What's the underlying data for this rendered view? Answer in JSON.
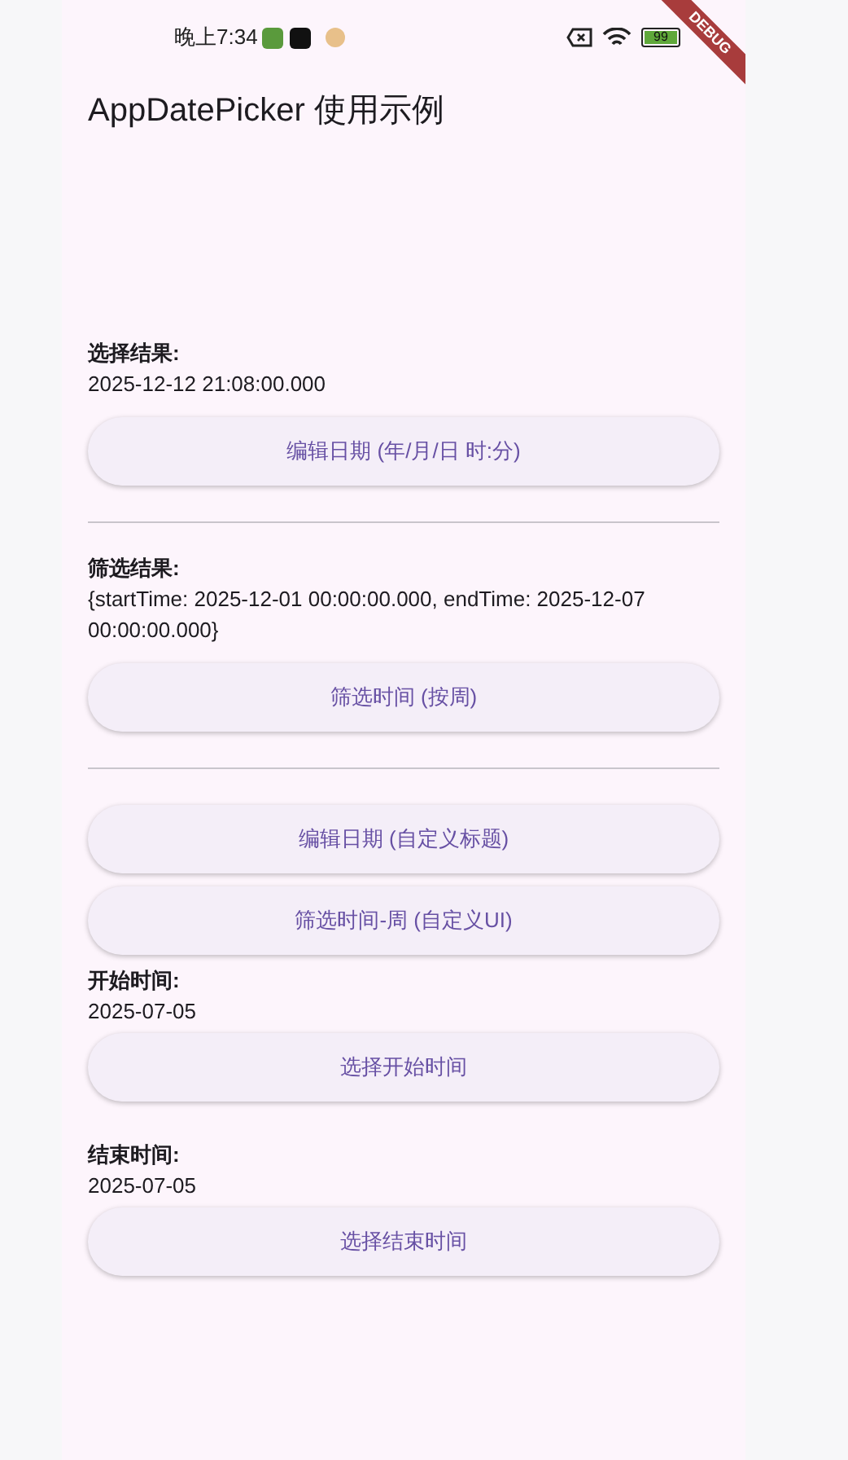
{
  "status_bar": {
    "time": "晚上7:34",
    "battery": "99"
  },
  "debug_banner": "DEBUG",
  "title": "AppDatePicker 使用示例",
  "sections": [
    {
      "kind": "result",
      "label": "选择结果:",
      "value": "2025-12-12 21:08:00.000",
      "button": "编辑日期 (年/月/日 时:分)"
    },
    {
      "kind": "divider"
    },
    {
      "kind": "result",
      "label": "筛选结果:",
      "value": "{startTime: 2025-12-01 00:00:00.000, endTime: 2025-12-07 00:00:00.000}",
      "button": "筛选时间 (按周)"
    },
    {
      "kind": "divider"
    },
    {
      "kind": "buttons",
      "buttons": [
        "编辑日期 (自定义标题)",
        "筛选时间-周 (自定义UI)"
      ]
    },
    {
      "kind": "field",
      "label": "开始时间:",
      "value": "2025-07-05",
      "button": "选择开始时间"
    },
    {
      "kind": "field",
      "label": "结束时间:",
      "value": "2025-07-05",
      "button": "选择结束时间"
    }
  ]
}
